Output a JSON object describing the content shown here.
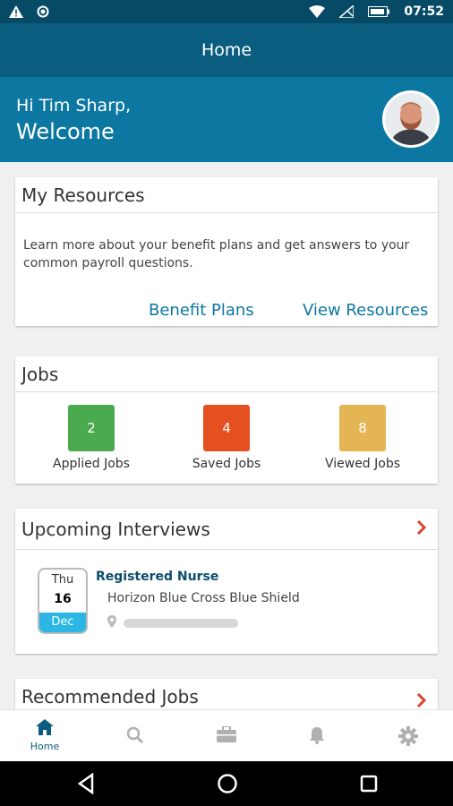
{
  "status_bar": {
    "time": "07:52"
  },
  "app_bar": {
    "title": "Home"
  },
  "welcome": {
    "greeting": "Hi Tim Sharp,",
    "title": "Welcome"
  },
  "resources": {
    "title": "My Resources",
    "description": "Learn more about your benefit plans and get answers to your common payroll questions.",
    "benefit_plans": "Benefit Plans",
    "view_resources": "View Resources"
  },
  "jobs": {
    "title": "Jobs",
    "stats": [
      {
        "count": "2",
        "label": "Applied Jobs",
        "color": "#4caa4e"
      },
      {
        "count": "4",
        "label": "Saved Jobs",
        "color": "#e4501f"
      },
      {
        "count": "8",
        "label": "Viewed Jobs",
        "color": "#e4b653"
      }
    ]
  },
  "interviews": {
    "title": "Upcoming Interviews",
    "item": {
      "day_of_week": "Thu",
      "day": "16",
      "month": "Dec",
      "job_title": "Registered Nurse",
      "company": "Horizon Blue Cross Blue Shield"
    }
  },
  "recommended": {
    "title": "Recommended Jobs"
  },
  "bottom_nav": {
    "home": "Home"
  },
  "colors": {
    "primary": "#0c77a1",
    "appbar": "#0a5d7f",
    "chevron": "#d9452a"
  }
}
